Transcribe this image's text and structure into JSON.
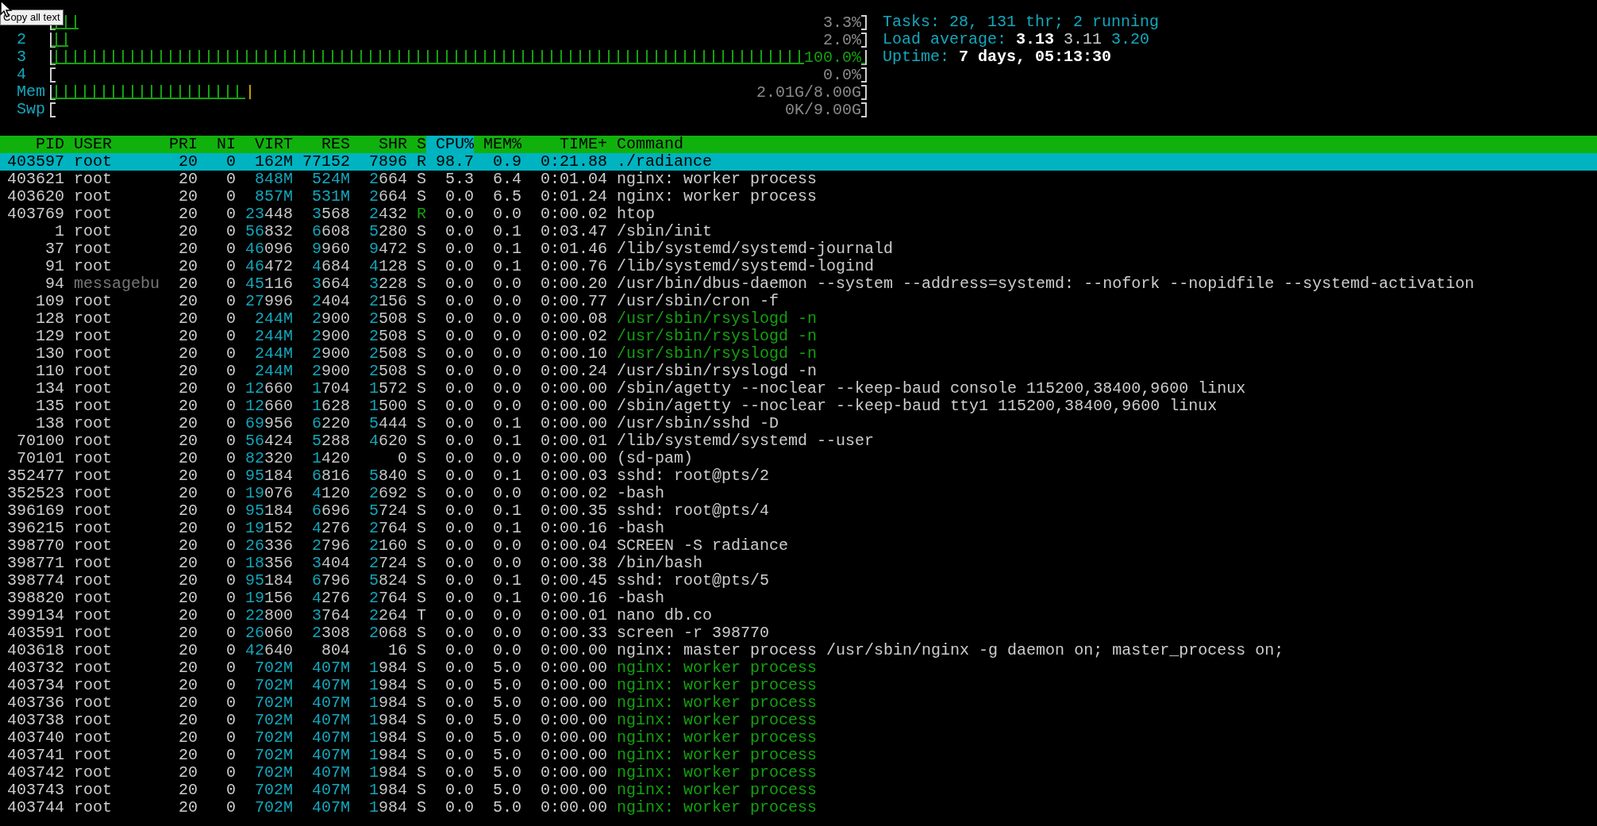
{
  "tooltip": "Copy all text",
  "meters": [
    {
      "kind": "cpu",
      "level": 0.033,
      "value": "3.3%"
    },
    {
      "kind": "cpu",
      "label": "2",
      "level": 0.02,
      "value": "2.0%"
    },
    {
      "kind": "cpu",
      "label": "3",
      "level": 1.0,
      "value": "100.0%"
    },
    {
      "kind": "cpu",
      "label": "4",
      "value": "0.0%"
    },
    {
      "kind": "memory",
      "label": "Mem",
      "level": 0.25,
      "value": "2.01G/8.00G"
    },
    {
      "kind": "swap",
      "label": "Swp",
      "value": "0K/9.00G"
    }
  ],
  "info": {
    "tasks": {
      "label": "Tasks:",
      "value": "28, 131 thr; 2 running"
    },
    "load": {
      "label": "Load average:",
      "values": [
        "3.13",
        "3.11",
        "3.20"
      ]
    },
    "uptime": {
      "label": "Uptime:",
      "value": "7 days, 05:13:30"
    }
  },
  "columns": [
    {
      "label": "PID",
      "sorted": false
    },
    {
      "label": "USER",
      "sorted": false
    },
    {
      "label": "PRI",
      "sorted": false
    },
    {
      "label": "NI",
      "sorted": false
    },
    {
      "label": "VIRT",
      "sorted": false
    },
    {
      "label": "RES",
      "sorted": false
    },
    {
      "label": "SHR",
      "sorted": false
    },
    {
      "label": "S",
      "sorted": false
    },
    {
      "label": "CPU%",
      "sorted": true
    },
    {
      "label": "MEM%",
      "sorted": false
    },
    {
      "label": "TIME+",
      "sorted": false
    },
    {
      "label": "Command",
      "sorted": false
    }
  ],
  "rows": [
    {
      "cells": [
        "403597",
        "root",
        "20",
        "0",
        "162M",
        "77152",
        "7896",
        "R",
        "98.7",
        "0.9",
        "0:21.88",
        "./radiance"
      ],
      "selected": true,
      "running": true,
      "thread": false,
      "user_shadowed": false
    },
    {
      "cells": [
        "403621",
        "root",
        "20",
        "0",
        "848M",
        "524M",
        "2664",
        "S",
        "5.3",
        "6.4",
        "0:01.04",
        "nginx: worker process"
      ],
      "selected": false,
      "running": false,
      "thread": false,
      "user_shadowed": false
    },
    {
      "cells": [
        "403620",
        "root",
        "20",
        "0",
        "857M",
        "531M",
        "2664",
        "S",
        "0.0",
        "6.5",
        "0:01.24",
        "nginx: worker process"
      ],
      "selected": false,
      "running": false,
      "thread": false,
      "user_shadowed": false
    },
    {
      "cells": [
        "403769",
        "root",
        "20",
        "0",
        "23448",
        "3568",
        "2432",
        "R",
        "0.0",
        "0.0",
        "0:00.02",
        "htop"
      ],
      "selected": false,
      "running": true,
      "thread": false,
      "user_shadowed": false
    },
    {
      "cells": [
        "1",
        "root",
        "20",
        "0",
        "56832",
        "6608",
        "5280",
        "S",
        "0.0",
        "0.1",
        "0:03.47",
        "/sbin/init"
      ],
      "selected": false,
      "running": false,
      "thread": false,
      "user_shadowed": false
    },
    {
      "cells": [
        "37",
        "root",
        "20",
        "0",
        "46096",
        "9960",
        "9472",
        "S",
        "0.0",
        "0.1",
        "0:01.46",
        "/lib/systemd/systemd-journald"
      ],
      "selected": false,
      "running": false,
      "thread": false,
      "user_shadowed": false
    },
    {
      "cells": [
        "91",
        "root",
        "20",
        "0",
        "46472",
        "4684",
        "4128",
        "S",
        "0.0",
        "0.1",
        "0:00.76",
        "/lib/systemd/systemd-logind"
      ],
      "selected": false,
      "running": false,
      "thread": false,
      "user_shadowed": false
    },
    {
      "cells": [
        "94",
        "messagebu",
        "20",
        "0",
        "45116",
        "3664",
        "3228",
        "S",
        "0.0",
        "0.0",
        "0:00.20",
        "/usr/bin/dbus-daemon --system --address=systemd: --nofork --nopidfile --systemd-activation"
      ],
      "selected": false,
      "running": false,
      "thread": false,
      "user_shadowed": true
    },
    {
      "cells": [
        "109",
        "root",
        "20",
        "0",
        "27996",
        "2404",
        "2156",
        "S",
        "0.0",
        "0.0",
        "0:00.77",
        "/usr/sbin/cron -f"
      ],
      "selected": false,
      "running": false,
      "thread": false,
      "user_shadowed": false
    },
    {
      "cells": [
        "128",
        "root",
        "20",
        "0",
        "244M",
        "2900",
        "2508",
        "S",
        "0.0",
        "0.0",
        "0:00.08",
        "/usr/sbin/rsyslogd -n"
      ],
      "selected": false,
      "running": false,
      "thread": true,
      "user_shadowed": false
    },
    {
      "cells": [
        "129",
        "root",
        "20",
        "0",
        "244M",
        "2900",
        "2508",
        "S",
        "0.0",
        "0.0",
        "0:00.02",
        "/usr/sbin/rsyslogd -n"
      ],
      "selected": false,
      "running": false,
      "thread": true,
      "user_shadowed": false
    },
    {
      "cells": [
        "130",
        "root",
        "20",
        "0",
        "244M",
        "2900",
        "2508",
        "S",
        "0.0",
        "0.0",
        "0:00.10",
        "/usr/sbin/rsyslogd -n"
      ],
      "selected": false,
      "running": false,
      "thread": true,
      "user_shadowed": false
    },
    {
      "cells": [
        "110",
        "root",
        "20",
        "0",
        "244M",
        "2900",
        "2508",
        "S",
        "0.0",
        "0.0",
        "0:00.24",
        "/usr/sbin/rsyslogd -n"
      ],
      "selected": false,
      "running": false,
      "thread": false,
      "user_shadowed": false
    },
    {
      "cells": [
        "134",
        "root",
        "20",
        "0",
        "12660",
        "1704",
        "1572",
        "S",
        "0.0",
        "0.0",
        "0:00.00",
        "/sbin/agetty --noclear --keep-baud console 115200,38400,9600 linux"
      ],
      "selected": false,
      "running": false,
      "thread": false,
      "user_shadowed": false
    },
    {
      "cells": [
        "135",
        "root",
        "20",
        "0",
        "12660",
        "1628",
        "1500",
        "S",
        "0.0",
        "0.0",
        "0:00.00",
        "/sbin/agetty --noclear --keep-baud tty1 115200,38400,9600 linux"
      ],
      "selected": false,
      "running": false,
      "thread": false,
      "user_shadowed": false
    },
    {
      "cells": [
        "138",
        "root",
        "20",
        "0",
        "69956",
        "6220",
        "5444",
        "S",
        "0.0",
        "0.1",
        "0:00.00",
        "/usr/sbin/sshd -D"
      ],
      "selected": false,
      "running": false,
      "thread": false,
      "user_shadowed": false
    },
    {
      "cells": [
        "70100",
        "root",
        "20",
        "0",
        "56424",
        "5288",
        "4620",
        "S",
        "0.0",
        "0.1",
        "0:00.01",
        "/lib/systemd/systemd --user"
      ],
      "selected": false,
      "running": false,
      "thread": false,
      "user_shadowed": false
    },
    {
      "cells": [
        "70101",
        "root",
        "20",
        "0",
        "82320",
        "1420",
        "0",
        "S",
        "0.0",
        "0.0",
        "0:00.00",
        "(sd-pam)"
      ],
      "selected": false,
      "running": false,
      "thread": false,
      "user_shadowed": false
    },
    {
      "cells": [
        "352477",
        "root",
        "20",
        "0",
        "95184",
        "6816",
        "5840",
        "S",
        "0.0",
        "0.1",
        "0:00.03",
        "sshd: root@pts/2"
      ],
      "selected": false,
      "running": false,
      "thread": false,
      "user_shadowed": false
    },
    {
      "cells": [
        "352523",
        "root",
        "20",
        "0",
        "19076",
        "4120",
        "2692",
        "S",
        "0.0",
        "0.0",
        "0:00.02",
        "-bash"
      ],
      "selected": false,
      "running": false,
      "thread": false,
      "user_shadowed": false
    },
    {
      "cells": [
        "396169",
        "root",
        "20",
        "0",
        "95184",
        "6696",
        "5724",
        "S",
        "0.0",
        "0.1",
        "0:00.35",
        "sshd: root@pts/4"
      ],
      "selected": false,
      "running": false,
      "thread": false,
      "user_shadowed": false
    },
    {
      "cells": [
        "396215",
        "root",
        "20",
        "0",
        "19152",
        "4276",
        "2764",
        "S",
        "0.0",
        "0.1",
        "0:00.16",
        "-bash"
      ],
      "selected": false,
      "running": false,
      "thread": false,
      "user_shadowed": false
    },
    {
      "cells": [
        "398770",
        "root",
        "20",
        "0",
        "26336",
        "2796",
        "2160",
        "S",
        "0.0",
        "0.0",
        "0:00.04",
        "SCREEN -S radiance"
      ],
      "selected": false,
      "running": false,
      "thread": false,
      "user_shadowed": false
    },
    {
      "cells": [
        "398771",
        "root",
        "20",
        "0",
        "18356",
        "3404",
        "2724",
        "S",
        "0.0",
        "0.0",
        "0:00.38",
        "/bin/bash"
      ],
      "selected": false,
      "running": false,
      "thread": false,
      "user_shadowed": false
    },
    {
      "cells": [
        "398774",
        "root",
        "20",
        "0",
        "95184",
        "6796",
        "5824",
        "S",
        "0.0",
        "0.1",
        "0:00.45",
        "sshd: root@pts/5"
      ],
      "selected": false,
      "running": false,
      "thread": false,
      "user_shadowed": false
    },
    {
      "cells": [
        "398820",
        "root",
        "20",
        "0",
        "19156",
        "4276",
        "2764",
        "S",
        "0.0",
        "0.1",
        "0:00.16",
        "-bash"
      ],
      "selected": false,
      "running": false,
      "thread": false,
      "user_shadowed": false
    },
    {
      "cells": [
        "399134",
        "root",
        "20",
        "0",
        "22800",
        "3764",
        "2264",
        "T",
        "0.0",
        "0.0",
        "0:00.01",
        "nano db.co"
      ],
      "selected": false,
      "running": false,
      "thread": false,
      "user_shadowed": false
    },
    {
      "cells": [
        "403591",
        "root",
        "20",
        "0",
        "26060",
        "2308",
        "2068",
        "S",
        "0.0",
        "0.0",
        "0:00.33",
        "screen -r 398770"
      ],
      "selected": false,
      "running": false,
      "thread": false,
      "user_shadowed": false
    },
    {
      "cells": [
        "403618",
        "root",
        "20",
        "0",
        "42640",
        "804",
        "16",
        "S",
        "0.0",
        "0.0",
        "0:00.00",
        "nginx: master process /usr/sbin/nginx -g daemon on; master_process on;"
      ],
      "selected": false,
      "running": false,
      "thread": false,
      "user_shadowed": false
    },
    {
      "cells": [
        "403732",
        "root",
        "20",
        "0",
        "702M",
        "407M",
        "1984",
        "S",
        "0.0",
        "5.0",
        "0:00.00",
        "nginx: worker process"
      ],
      "selected": false,
      "running": false,
      "thread": true,
      "user_shadowed": false
    },
    {
      "cells": [
        "403734",
        "root",
        "20",
        "0",
        "702M",
        "407M",
        "1984",
        "S",
        "0.0",
        "5.0",
        "0:00.00",
        "nginx: worker process"
      ],
      "selected": false,
      "running": false,
      "thread": true,
      "user_shadowed": false
    },
    {
      "cells": [
        "403736",
        "root",
        "20",
        "0",
        "702M",
        "407M",
        "1984",
        "S",
        "0.0",
        "5.0",
        "0:00.00",
        "nginx: worker process"
      ],
      "selected": false,
      "running": false,
      "thread": true,
      "user_shadowed": false
    },
    {
      "cells": [
        "403738",
        "root",
        "20",
        "0",
        "702M",
        "407M",
        "1984",
        "S",
        "0.0",
        "5.0",
        "0:00.00",
        "nginx: worker process"
      ],
      "selected": false,
      "running": false,
      "thread": true,
      "user_shadowed": false
    },
    {
      "cells": [
        "403740",
        "root",
        "20",
        "0",
        "702M",
        "407M",
        "1984",
        "S",
        "0.0",
        "5.0",
        "0:00.00",
        "nginx: worker process"
      ],
      "selected": false,
      "running": false,
      "thread": true,
      "user_shadowed": false
    },
    {
      "cells": [
        "403741",
        "root",
        "20",
        "0",
        "702M",
        "407M",
        "1984",
        "S",
        "0.0",
        "5.0",
        "0:00.00",
        "nginx: worker process"
      ],
      "selected": false,
      "running": false,
      "thread": true,
      "user_shadowed": false
    },
    {
      "cells": [
        "403742",
        "root",
        "20",
        "0",
        "702M",
        "407M",
        "1984",
        "S",
        "0.0",
        "5.0",
        "0:00.00",
        "nginx: worker process"
      ],
      "selected": false,
      "running": false,
      "thread": true,
      "user_shadowed": false
    },
    {
      "cells": [
        "403743",
        "root",
        "20",
        "0",
        "702M",
        "407M",
        "1984",
        "S",
        "0.0",
        "5.0",
        "0:00.00",
        "nginx: worker process"
      ],
      "selected": false,
      "running": false,
      "thread": true,
      "user_shadowed": false
    },
    {
      "cells": [
        "403744",
        "root",
        "20",
        "0",
        "702M",
        "407M",
        "1984",
        "S",
        "0.0",
        "5.0",
        "0:00.00",
        "nginx: worker process"
      ],
      "selected": false,
      "running": false,
      "thread": true,
      "user_shadowed": false
    }
  ]
}
